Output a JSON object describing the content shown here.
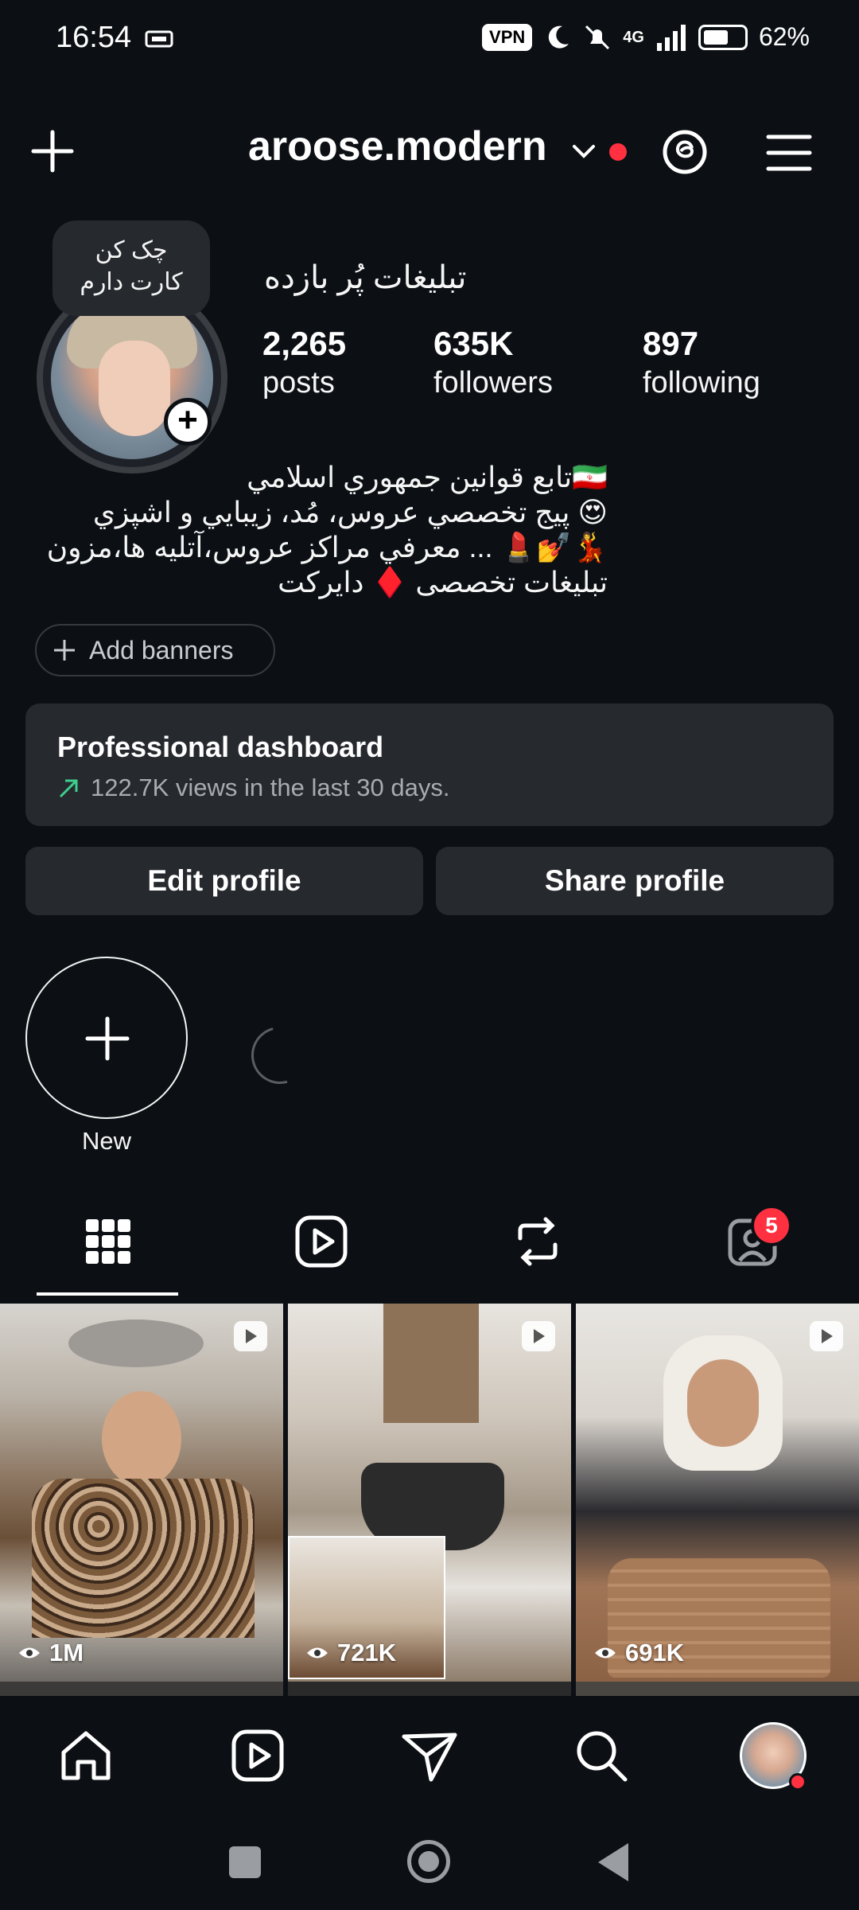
{
  "status_bar": {
    "time": "16:54",
    "vpn": "VPN",
    "network": "4G",
    "battery": "62%"
  },
  "header": {
    "username": "aroose.modern",
    "icons": [
      "plus-icon",
      "chevron-down-icon",
      "threads-icon",
      "menu-icon"
    ],
    "accent": "#ff3040"
  },
  "profile": {
    "note_line1": "چک کن",
    "note_line2": "کارت دارم",
    "name": "تبليغات پُر بازده",
    "stats": [
      {
        "value": "2,265",
        "label": "posts"
      },
      {
        "value": "635K",
        "label": "followers"
      },
      {
        "value": "897",
        "label": "following"
      }
    ],
    "bio": [
      "🇮🇷تابع قوانين جمهوري اسلامي",
      "😍 پيج تخصصي عروس، مُد، زيبايي و اشپزي",
      "💃💅💄 ... معرفي مراكز عروس،آتليه ها،مزون",
      "تبليغات تخصصی ♦️ دايركت"
    ],
    "add_banners": "Add banners"
  },
  "dashboard": {
    "title": "Professional dashboard",
    "subtitle": "122.7K views in the last 30 days.",
    "trend_color": "#3ecf8e"
  },
  "actions": {
    "edit": "Edit profile",
    "share": "Share profile"
  },
  "stories": {
    "new_label": "New"
  },
  "tabs": {
    "items": [
      "grid-icon",
      "reels-icon",
      "reposts-icon",
      "tagged-icon"
    ],
    "tagged_badge": "5"
  },
  "grid": {
    "tiles": [
      {
        "views": "1M"
      },
      {
        "views": "721K"
      },
      {
        "views": "691K"
      }
    ]
  },
  "bottom_nav": {
    "items": [
      "home-icon",
      "reels-icon",
      "direct-icon",
      "search-icon",
      "profile-avatar"
    ]
  }
}
